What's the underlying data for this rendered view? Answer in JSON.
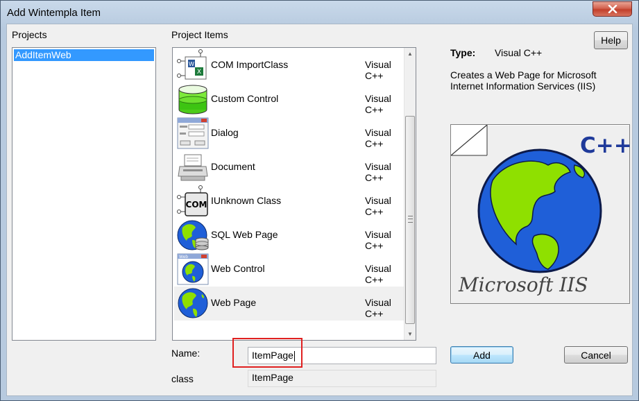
{
  "window": {
    "title": "Add Wintempla Item"
  },
  "projects": {
    "label": "Projects",
    "items": [
      "AddItemWeb"
    ]
  },
  "project_items": {
    "label": "Project Items",
    "items": [
      {
        "name": "COM ImportClass",
        "type": "Visual C++",
        "icon": "com-import-class-icon"
      },
      {
        "name": "Custom Control",
        "type": "Visual C++",
        "icon": "custom-control-icon"
      },
      {
        "name": "Dialog",
        "type": "Visual C++",
        "icon": "dialog-icon"
      },
      {
        "name": "Document",
        "type": "Visual C++",
        "icon": "document-icon"
      },
      {
        "name": "IUnknown Class",
        "type": "Visual C++",
        "icon": "iunknown-class-icon"
      },
      {
        "name": "SQL Web Page",
        "type": "Visual C++",
        "icon": "sql-web-page-icon"
      },
      {
        "name": "Web Control",
        "type": "Visual C++",
        "icon": "web-control-icon"
      },
      {
        "name": "Web Page",
        "type": "Visual C++",
        "icon": "web-page-icon",
        "selected": true
      }
    ]
  },
  "details": {
    "type_label": "Type:",
    "type_value": "Visual C++",
    "desc_line1": "Creates a Web Page for Microsoft",
    "desc_line2": "Internet Information Services (IIS)",
    "preview_lang": "C++",
    "preview_caption": "Microsoft IIS"
  },
  "form": {
    "name_label": "Name:",
    "name_value": "ItemPage",
    "class_label": "class",
    "class_value": "ItemPage"
  },
  "buttons": {
    "help": "Help",
    "add": "Add",
    "cancel": "Cancel"
  },
  "colors": {
    "selection": "#3399ff",
    "highlight_box": "#e02020",
    "globe_ocean": "#1f5fd8",
    "globe_land": "#8fe000"
  }
}
